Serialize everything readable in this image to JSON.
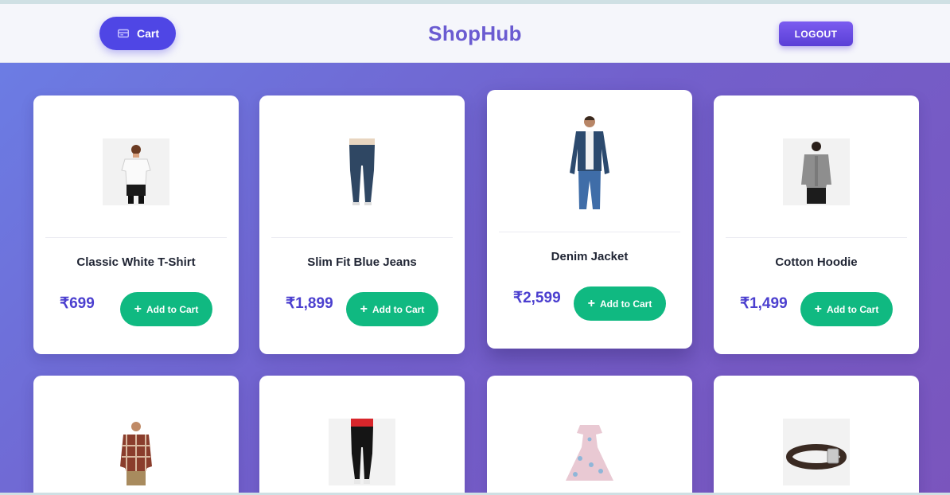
{
  "app": {
    "brand": "ShopHub"
  },
  "header": {
    "cart_label": "Cart",
    "logout_label": "LOGOUT"
  },
  "colors": {
    "accent": "#4f46e5",
    "add_button": "#10b981",
    "price": "#4b3fcf"
  },
  "products": [
    {
      "name": "Classic White T-Shirt",
      "price": "₹699",
      "button": "Add to Cart",
      "icon": "white-tshirt-image"
    },
    {
      "name": "Slim Fit Blue Jeans",
      "price": "₹1,899",
      "button": "Add to Cart",
      "icon": "blue-jeans-image"
    },
    {
      "name": "Denim Jacket",
      "price": "₹2,599",
      "button": "Add to Cart",
      "icon": "denim-jacket-image"
    },
    {
      "name": "Cotton Hoodie",
      "price": "₹1,499",
      "button": "Add to Cart",
      "icon": "grey-hoodie-image"
    },
    {
      "name": "",
      "price": "",
      "button": "",
      "icon": "plaid-shirt-image"
    },
    {
      "name": "",
      "price": "",
      "button": "",
      "icon": "track-pants-image"
    },
    {
      "name": "",
      "price": "",
      "button": "",
      "icon": "floral-dress-image"
    },
    {
      "name": "",
      "price": "",
      "button": "",
      "icon": "leather-belt-image"
    }
  ]
}
